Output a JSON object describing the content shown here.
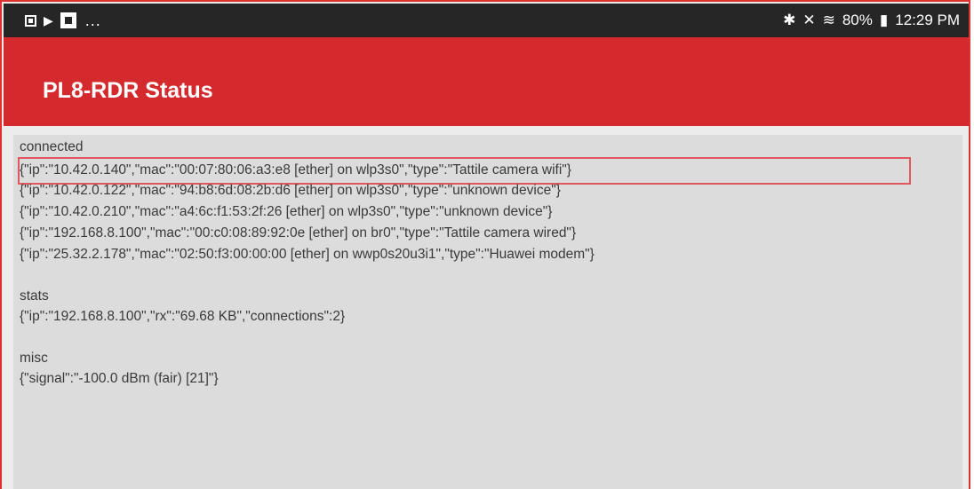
{
  "status_bar": {
    "left_icons": [
      "notification-square-icon",
      "play-store-icon",
      "flipboard-icon"
    ],
    "overflow": "...",
    "right_icons": [
      "bluetooth-icon",
      "mute-icon",
      "wifi-icon",
      "battery-icon"
    ],
    "battery_percent": "80%",
    "time": "12:29 PM"
  },
  "app_bar": {
    "title": "PL8-RDR Status"
  },
  "sections": {
    "connected": {
      "heading": "connected",
      "lines": [
        "{\"ip\":\"10.42.0.140\",\"mac\":\"00:07:80:06:a3:e8 [ether] on wlp3s0\",\"type\":\"Tattile camera wifi\"}",
        "{\"ip\":\"10.42.0.122\",\"mac\":\"94:b8:6d:08:2b:d6 [ether] on wlp3s0\",\"type\":\"unknown device\"}",
        "{\"ip\":\"10.42.0.210\",\"mac\":\"a4:6c:f1:53:2f:26 [ether] on wlp3s0\",\"type\":\"unknown device\"}",
        "{\"ip\":\"192.168.8.100\",\"mac\":\"00:c0:08:89:92:0e [ether] on br0\",\"type\":\"Tattile camera wired\"}",
        "{\"ip\":\"25.32.2.178\",\"mac\":\"02:50:f3:00:00:00 [ether] on wwp0s20u3i1\",\"type\":\"Huawei modem\"}"
      ]
    },
    "stats": {
      "heading": "stats",
      "lines": [
        "{\"ip\":\"192.168.8.100\",\"rx\":\"69.68 KB\",\"connections\":2}"
      ]
    },
    "misc": {
      "heading": "misc",
      "lines": [
        "{\"signal\":\"-100.0 dBm (fair) [21]\"}"
      ]
    }
  },
  "colors": {
    "app_bar": "#d42a2e",
    "status_bar": "#262626",
    "content_bg": "#dcdcdc",
    "highlight_border": "#e0575e",
    "frame_border": "#e03131"
  }
}
